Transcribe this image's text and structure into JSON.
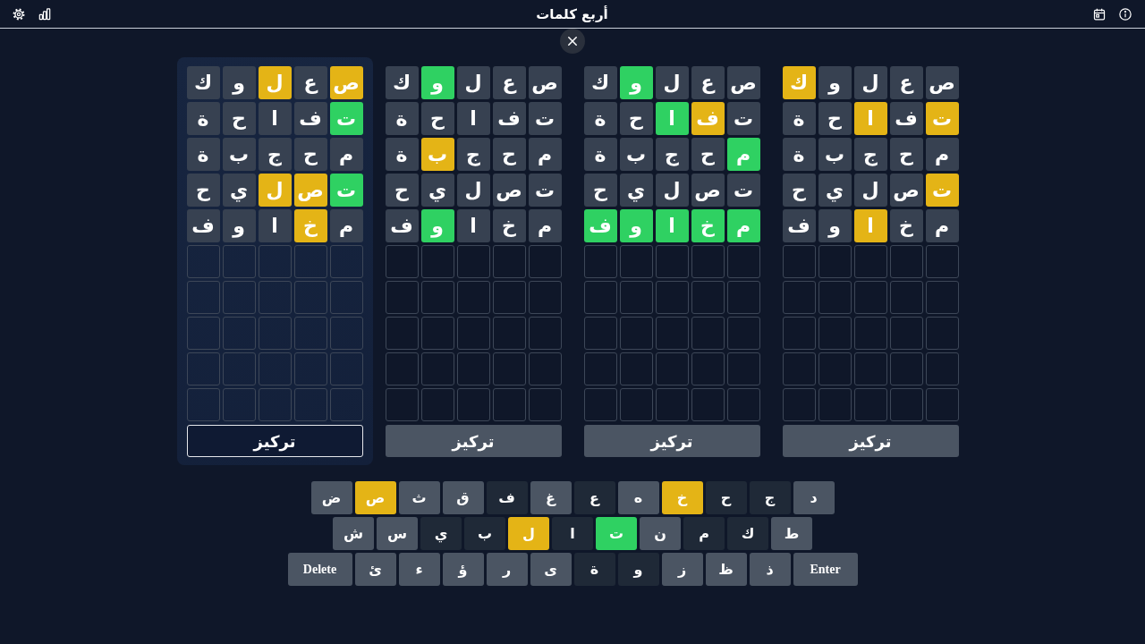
{
  "header": {
    "title": "أربع كلمات"
  },
  "boards": [
    {
      "selected": false,
      "focus_label": "تركيز",
      "rows": [
        {
          "tiles": [
            {
              "letter": "ص",
              "kind": "absent"
            },
            {
              "letter": "ع",
              "kind": "absent"
            },
            {
              "letter": "ل",
              "kind": "absent"
            },
            {
              "letter": "و",
              "kind": "absent"
            },
            {
              "letter": "ك",
              "kind": "present"
            }
          ]
        },
        {
          "tiles": [
            {
              "letter": "ت",
              "kind": "present"
            },
            {
              "letter": "ف",
              "kind": "absent"
            },
            {
              "letter": "ا",
              "kind": "present"
            },
            {
              "letter": "ح",
              "kind": "absent"
            },
            {
              "letter": "ة",
              "kind": "absent"
            }
          ]
        },
        {
          "tiles": [
            {
              "letter": "م",
              "kind": "absent"
            },
            {
              "letter": "ح",
              "kind": "absent"
            },
            {
              "letter": "ج",
              "kind": "absent"
            },
            {
              "letter": "ب",
              "kind": "absent"
            },
            {
              "letter": "ة",
              "kind": "absent"
            }
          ]
        },
        {
          "tiles": [
            {
              "letter": "ت",
              "kind": "present"
            },
            {
              "letter": "ص",
              "kind": "absent"
            },
            {
              "letter": "ل",
              "kind": "absent"
            },
            {
              "letter": "ي",
              "kind": "absent"
            },
            {
              "letter": "ح",
              "kind": "absent"
            }
          ]
        },
        {
          "tiles": [
            {
              "letter": "م",
              "kind": "absent"
            },
            {
              "letter": "خ",
              "kind": "absent"
            },
            {
              "letter": "ا",
              "kind": "present"
            },
            {
              "letter": "و",
              "kind": "absent"
            },
            {
              "letter": "ف",
              "kind": "absent"
            }
          ]
        },
        {
          "tiles": [
            {
              "kind": "empty"
            },
            {
              "kind": "empty"
            },
            {
              "kind": "empty"
            },
            {
              "kind": "empty"
            },
            {
              "kind": "empty"
            }
          ]
        },
        {
          "tiles": [
            {
              "kind": "empty"
            },
            {
              "kind": "empty"
            },
            {
              "kind": "empty"
            },
            {
              "kind": "empty"
            },
            {
              "kind": "empty"
            }
          ]
        },
        {
          "tiles": [
            {
              "kind": "empty"
            },
            {
              "kind": "empty"
            },
            {
              "kind": "empty"
            },
            {
              "kind": "empty"
            },
            {
              "kind": "empty"
            }
          ]
        },
        {
          "tiles": [
            {
              "kind": "empty"
            },
            {
              "kind": "empty"
            },
            {
              "kind": "empty"
            },
            {
              "kind": "empty"
            },
            {
              "kind": "empty"
            }
          ]
        },
        {
          "tiles": [
            {
              "kind": "empty"
            },
            {
              "kind": "empty"
            },
            {
              "kind": "empty"
            },
            {
              "kind": "empty"
            },
            {
              "kind": "empty"
            }
          ]
        }
      ]
    },
    {
      "selected": false,
      "focus_label": "تركيز",
      "rows": [
        {
          "tiles": [
            {
              "letter": "ص",
              "kind": "absent"
            },
            {
              "letter": "ع",
              "kind": "absent"
            },
            {
              "letter": "ل",
              "kind": "absent"
            },
            {
              "letter": "و",
              "kind": "correct"
            },
            {
              "letter": "ك",
              "kind": "absent"
            }
          ]
        },
        {
          "tiles": [
            {
              "letter": "ت",
              "kind": "absent"
            },
            {
              "letter": "ف",
              "kind": "present"
            },
            {
              "letter": "ا",
              "kind": "correct"
            },
            {
              "letter": "ح",
              "kind": "absent"
            },
            {
              "letter": "ة",
              "kind": "absent"
            }
          ]
        },
        {
          "tiles": [
            {
              "letter": "م",
              "kind": "correct"
            },
            {
              "letter": "ح",
              "kind": "absent"
            },
            {
              "letter": "ج",
              "kind": "absent"
            },
            {
              "letter": "ب",
              "kind": "absent"
            },
            {
              "letter": "ة",
              "kind": "absent"
            }
          ]
        },
        {
          "tiles": [
            {
              "letter": "ت",
              "kind": "absent"
            },
            {
              "letter": "ص",
              "kind": "absent"
            },
            {
              "letter": "ل",
              "kind": "absent"
            },
            {
              "letter": "ي",
              "kind": "absent"
            },
            {
              "letter": "ح",
              "kind": "absent"
            }
          ]
        },
        {
          "tiles": [
            {
              "letter": "م",
              "kind": "correct"
            },
            {
              "letter": "خ",
              "kind": "correct"
            },
            {
              "letter": "ا",
              "kind": "correct"
            },
            {
              "letter": "و",
              "kind": "correct"
            },
            {
              "letter": "ف",
              "kind": "correct"
            }
          ]
        },
        {
          "tiles": [
            {
              "kind": "empty"
            },
            {
              "kind": "empty"
            },
            {
              "kind": "empty"
            },
            {
              "kind": "empty"
            },
            {
              "kind": "empty"
            }
          ]
        },
        {
          "tiles": [
            {
              "kind": "empty"
            },
            {
              "kind": "empty"
            },
            {
              "kind": "empty"
            },
            {
              "kind": "empty"
            },
            {
              "kind": "empty"
            }
          ]
        },
        {
          "tiles": [
            {
              "kind": "empty"
            },
            {
              "kind": "empty"
            },
            {
              "kind": "empty"
            },
            {
              "kind": "empty"
            },
            {
              "kind": "empty"
            }
          ]
        },
        {
          "tiles": [
            {
              "kind": "empty"
            },
            {
              "kind": "empty"
            },
            {
              "kind": "empty"
            },
            {
              "kind": "empty"
            },
            {
              "kind": "empty"
            }
          ]
        },
        {
          "tiles": [
            {
              "kind": "empty"
            },
            {
              "kind": "empty"
            },
            {
              "kind": "empty"
            },
            {
              "kind": "empty"
            },
            {
              "kind": "empty"
            }
          ]
        }
      ]
    },
    {
      "selected": false,
      "focus_label": "تركيز",
      "rows": [
        {
          "tiles": [
            {
              "letter": "ص",
              "kind": "absent"
            },
            {
              "letter": "ع",
              "kind": "absent"
            },
            {
              "letter": "ل",
              "kind": "absent"
            },
            {
              "letter": "و",
              "kind": "correct"
            },
            {
              "letter": "ك",
              "kind": "absent"
            }
          ]
        },
        {
          "tiles": [
            {
              "letter": "ت",
              "kind": "absent"
            },
            {
              "letter": "ف",
              "kind": "absent"
            },
            {
              "letter": "ا",
              "kind": "absent"
            },
            {
              "letter": "ح",
              "kind": "absent"
            },
            {
              "letter": "ة",
              "kind": "absent"
            }
          ]
        },
        {
          "tiles": [
            {
              "letter": "م",
              "kind": "absent"
            },
            {
              "letter": "ح",
              "kind": "absent"
            },
            {
              "letter": "ج",
              "kind": "absent"
            },
            {
              "letter": "ب",
              "kind": "present"
            },
            {
              "letter": "ة",
              "kind": "absent"
            }
          ]
        },
        {
          "tiles": [
            {
              "letter": "ت",
              "kind": "absent"
            },
            {
              "letter": "ص",
              "kind": "absent"
            },
            {
              "letter": "ل",
              "kind": "absent"
            },
            {
              "letter": "ي",
              "kind": "absent"
            },
            {
              "letter": "ح",
              "kind": "absent"
            }
          ]
        },
        {
          "tiles": [
            {
              "letter": "م",
              "kind": "absent"
            },
            {
              "letter": "خ",
              "kind": "absent"
            },
            {
              "letter": "ا",
              "kind": "absent"
            },
            {
              "letter": "و",
              "kind": "correct"
            },
            {
              "letter": "ف",
              "kind": "absent"
            }
          ]
        },
        {
          "tiles": [
            {
              "kind": "empty"
            },
            {
              "kind": "empty"
            },
            {
              "kind": "empty"
            },
            {
              "kind": "empty"
            },
            {
              "kind": "empty"
            }
          ]
        },
        {
          "tiles": [
            {
              "kind": "empty"
            },
            {
              "kind": "empty"
            },
            {
              "kind": "empty"
            },
            {
              "kind": "empty"
            },
            {
              "kind": "empty"
            }
          ]
        },
        {
          "tiles": [
            {
              "kind": "empty"
            },
            {
              "kind": "empty"
            },
            {
              "kind": "empty"
            },
            {
              "kind": "empty"
            },
            {
              "kind": "empty"
            }
          ]
        },
        {
          "tiles": [
            {
              "kind": "empty"
            },
            {
              "kind": "empty"
            },
            {
              "kind": "empty"
            },
            {
              "kind": "empty"
            },
            {
              "kind": "empty"
            }
          ]
        },
        {
          "tiles": [
            {
              "kind": "empty"
            },
            {
              "kind": "empty"
            },
            {
              "kind": "empty"
            },
            {
              "kind": "empty"
            },
            {
              "kind": "empty"
            }
          ]
        }
      ]
    },
    {
      "selected": true,
      "focus_label": "تركيز",
      "rows": [
        {
          "tiles": [
            {
              "letter": "ص",
              "kind": "present"
            },
            {
              "letter": "ع",
              "kind": "absent"
            },
            {
              "letter": "ل",
              "kind": "present"
            },
            {
              "letter": "و",
              "kind": "absent"
            },
            {
              "letter": "ك",
              "kind": "absent"
            }
          ]
        },
        {
          "tiles": [
            {
              "letter": "ت",
              "kind": "correct"
            },
            {
              "letter": "ف",
              "kind": "absent"
            },
            {
              "letter": "ا",
              "kind": "absent"
            },
            {
              "letter": "ح",
              "kind": "absent"
            },
            {
              "letter": "ة",
              "kind": "absent"
            }
          ]
        },
        {
          "tiles": [
            {
              "letter": "م",
              "kind": "absent"
            },
            {
              "letter": "ح",
              "kind": "absent"
            },
            {
              "letter": "ج",
              "kind": "absent"
            },
            {
              "letter": "ب",
              "kind": "absent"
            },
            {
              "letter": "ة",
              "kind": "absent"
            }
          ]
        },
        {
          "tiles": [
            {
              "letter": "ت",
              "kind": "correct"
            },
            {
              "letter": "ص",
              "kind": "present"
            },
            {
              "letter": "ل",
              "kind": "present"
            },
            {
              "letter": "ي",
              "kind": "absent"
            },
            {
              "letter": "ح",
              "kind": "absent"
            }
          ]
        },
        {
          "tiles": [
            {
              "letter": "م",
              "kind": "absent"
            },
            {
              "letter": "خ",
              "kind": "present"
            },
            {
              "letter": "ا",
              "kind": "absent"
            },
            {
              "letter": "و",
              "kind": "absent"
            },
            {
              "letter": "ف",
              "kind": "absent"
            }
          ]
        },
        {
          "tiles": [
            {
              "kind": "empty"
            },
            {
              "kind": "empty"
            },
            {
              "kind": "empty"
            },
            {
              "kind": "empty"
            },
            {
              "kind": "empty"
            }
          ]
        },
        {
          "tiles": [
            {
              "kind": "empty"
            },
            {
              "kind": "empty"
            },
            {
              "kind": "empty"
            },
            {
              "kind": "empty"
            },
            {
              "kind": "empty"
            }
          ]
        },
        {
          "tiles": [
            {
              "kind": "empty"
            },
            {
              "kind": "empty"
            },
            {
              "kind": "empty"
            },
            {
              "kind": "empty"
            },
            {
              "kind": "empty"
            }
          ]
        },
        {
          "tiles": [
            {
              "kind": "empty"
            },
            {
              "kind": "empty"
            },
            {
              "kind": "empty"
            },
            {
              "kind": "empty"
            },
            {
              "kind": "empty"
            }
          ]
        },
        {
          "tiles": [
            {
              "kind": "empty"
            },
            {
              "kind": "empty"
            },
            {
              "kind": "empty"
            },
            {
              "kind": "empty"
            },
            {
              "kind": "empty"
            }
          ]
        }
      ]
    }
  ],
  "keyboard": {
    "rows": [
      {
        "keys": [
          {
            "label": "د",
            "kind": "letter",
            "color": "#4b5563"
          },
          {
            "label": "ج",
            "kind": "letter",
            "color": "#1f2937"
          },
          {
            "label": "ح",
            "kind": "letter",
            "color": "#1f2937"
          },
          {
            "label": "خ",
            "kind": "letter",
            "color": "#e4b416"
          },
          {
            "label": "ه",
            "kind": "letter",
            "color": "#4b5563"
          },
          {
            "label": "ع",
            "kind": "letter",
            "color": "#1f2937"
          },
          {
            "label": "غ",
            "kind": "letter",
            "color": "#4b5563"
          },
          {
            "label": "ف",
            "kind": "letter",
            "color": "#1f2937"
          },
          {
            "label": "ق",
            "kind": "letter",
            "color": "#4b5563"
          },
          {
            "label": "ث",
            "kind": "letter",
            "color": "#4b5563"
          },
          {
            "label": "ص",
            "kind": "letter",
            "color": "#e4b416"
          },
          {
            "label": "ض",
            "kind": "letter",
            "color": "#4b5563"
          }
        ]
      },
      {
        "keys": [
          {
            "label": "ط",
            "kind": "letter",
            "color": "#4b5563"
          },
          {
            "label": "ك",
            "kind": "letter",
            "color": "#1f2937"
          },
          {
            "label": "م",
            "kind": "letter",
            "color": "#1f2937"
          },
          {
            "label": "ن",
            "kind": "letter",
            "color": "#4b5563"
          },
          {
            "label": "ت",
            "kind": "letter",
            "color": "#2fd162"
          },
          {
            "label": "ا",
            "kind": "letter",
            "color": "#1f2937"
          },
          {
            "label": "ل",
            "kind": "letter",
            "color": "#e4b416"
          },
          {
            "label": "ب",
            "kind": "letter",
            "color": "#1f2937"
          },
          {
            "label": "ي",
            "kind": "letter",
            "color": "#1f2937"
          },
          {
            "label": "س",
            "kind": "letter",
            "color": "#4b5563"
          },
          {
            "label": "ش",
            "kind": "letter",
            "color": "#4b5563"
          }
        ]
      },
      {
        "keys": [
          {
            "label": "Enter",
            "kind": "action",
            "color": "#4b5563"
          },
          {
            "label": "ذ",
            "kind": "letter",
            "color": "#4b5563"
          },
          {
            "label": "ظ",
            "kind": "letter",
            "color": "#4b5563"
          },
          {
            "label": "ز",
            "kind": "letter",
            "color": "#4b5563"
          },
          {
            "label": "و",
            "kind": "letter",
            "color": "#1f2937"
          },
          {
            "label": "ة",
            "kind": "letter",
            "color": "#1f2937"
          },
          {
            "label": "ى",
            "kind": "letter",
            "color": "#4b5563"
          },
          {
            "label": "ر",
            "kind": "letter",
            "color": "#4b5563"
          },
          {
            "label": "ؤ",
            "kind": "letter",
            "color": "#4b5563"
          },
          {
            "label": "ء",
            "kind": "letter",
            "color": "#4b5563"
          },
          {
            "label": "ئ",
            "kind": "letter",
            "color": "#4b5563"
          },
          {
            "label": "Delete",
            "kind": "action",
            "color": "#4b5563"
          }
        ]
      }
    ]
  }
}
